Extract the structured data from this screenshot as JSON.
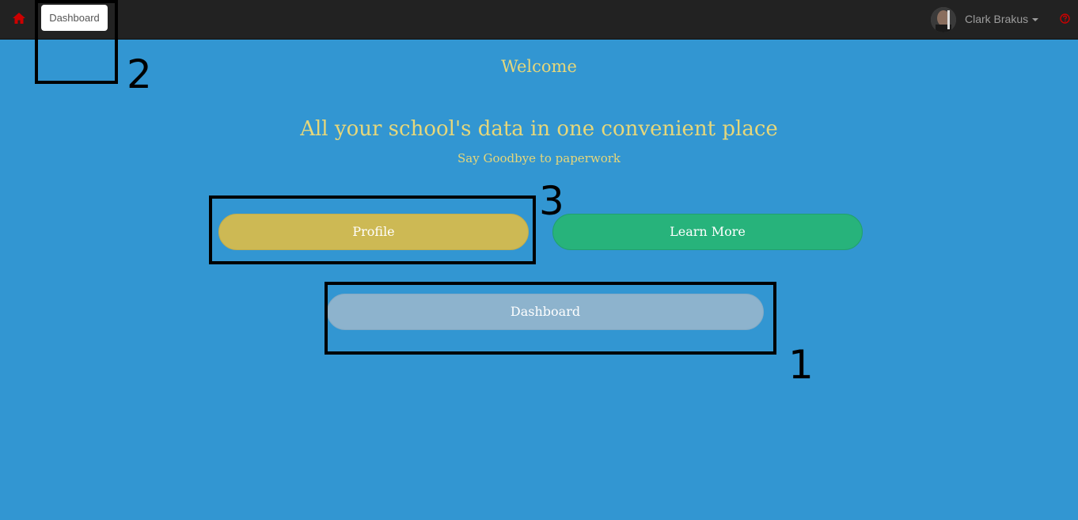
{
  "navbar": {
    "home_icon": "home-icon",
    "dashboard_label": "Dashboard",
    "user_name": "Clark Brakus",
    "help_icon": "question-circle-icon"
  },
  "hero": {
    "welcome": "Welcome",
    "headline": "All your school's data in one convenient place",
    "subline": "Say Goodbye to paperwork"
  },
  "buttons": {
    "profile": "Profile",
    "learn_more": "Learn More",
    "dashboard": "Dashboard"
  },
  "annotations": {
    "one": "1",
    "two": "2",
    "three": "3"
  },
  "colors": {
    "background": "#3296d2",
    "navbar": "#222222",
    "accent_text": "#e6d77a",
    "profile_button": "#cdb954",
    "learn_more_button": "#27b37b",
    "dashboard_button": "#8db3cd",
    "icon_red": "#cc0000"
  }
}
